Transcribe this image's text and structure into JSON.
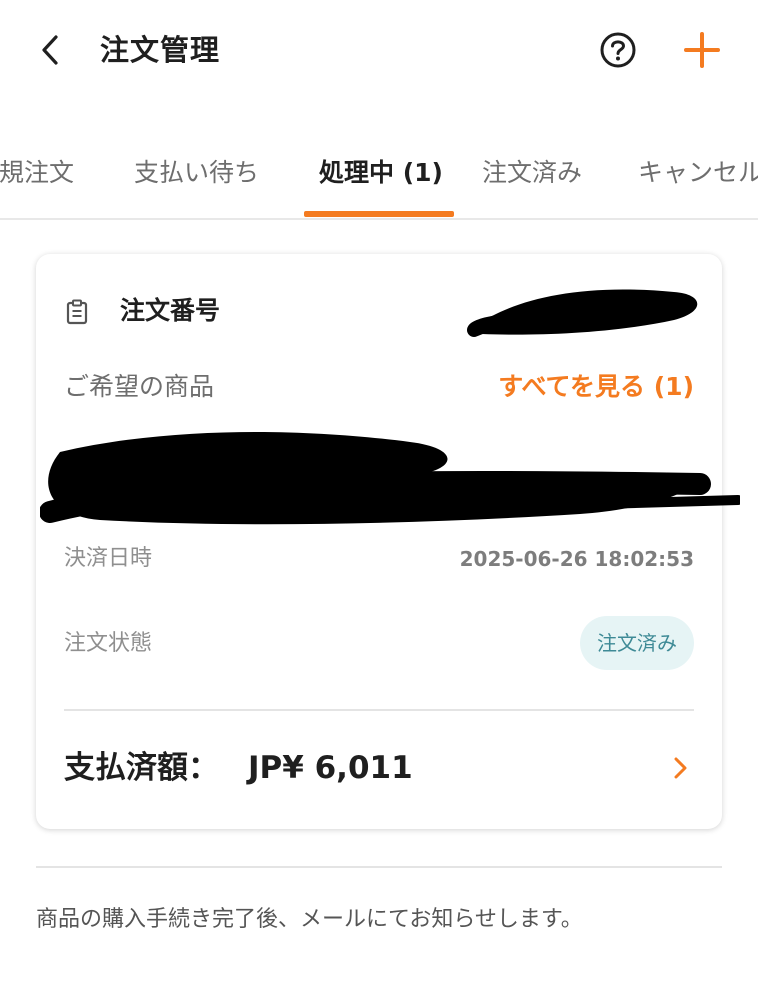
{
  "header": {
    "title": "注文管理"
  },
  "tabs": [
    {
      "label": "新規注文"
    },
    {
      "label": "支払い待ち"
    },
    {
      "label": "処理中 (1)"
    },
    {
      "label": "注文済み"
    },
    {
      "label": "キャンセル"
    }
  ],
  "order": {
    "number_label": "注文番号",
    "preferred_label": "ご希望の商品",
    "see_all": "すべてを見る (1)",
    "paid_date_label": "決済日時",
    "paid_date_value": "2025-06-26 18:02:53",
    "status_label": "注文状態",
    "status_value": "注文済み",
    "amount_label": "支払済額：",
    "amount_value": "JP¥ 6,011"
  },
  "footer": {
    "note": "商品の購入手続き完了後、メールにてお知らせします。"
  },
  "colors": {
    "accent": "#f47b20",
    "badge_bg": "#e6f4f5",
    "badge_text": "#3e8a96"
  },
  "icons": [
    "back-arrow-icon",
    "help-icon",
    "plus-icon",
    "document-icon",
    "chevron-right-icon"
  ]
}
